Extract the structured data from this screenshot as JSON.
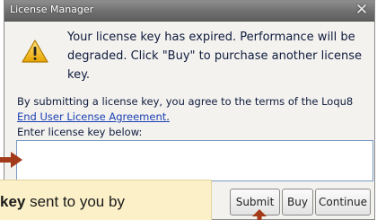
{
  "window": {
    "title": "License Manager",
    "close_glyph": "✕"
  },
  "message": {
    "icon": "warning-icon",
    "text": "Your license key has expired.  Performance will be degraded.  Click \"Buy\" to purchase another license key."
  },
  "terms": {
    "text": "By submitting a license key, you agree to the terms of the Loqu8",
    "link": "End User License Agreement",
    "link_suffix": "."
  },
  "key_entry": {
    "label": "Enter license key below:",
    "value": ""
  },
  "buttons": {
    "submit": "Submit",
    "buy": "Buy",
    "continue": "Continue"
  },
  "annotation": {
    "callout_bold": "key",
    "callout_text": " sent to you by",
    "color": "#a33a1a"
  },
  "colors": {
    "titlebar": "#7a7a7a",
    "dialog_bg": "#f3f2ef",
    "link": "#1a3fb3",
    "callout_bg": "#fbf0c8",
    "arrow": "#a33a1a"
  }
}
